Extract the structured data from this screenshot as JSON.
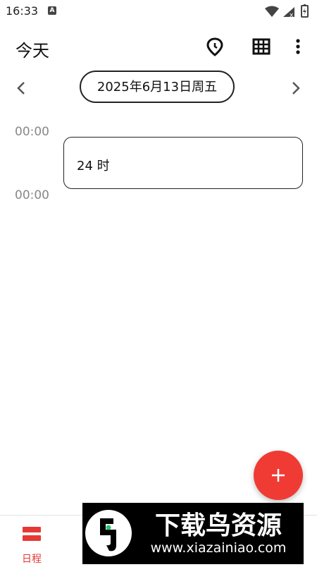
{
  "status_bar": {
    "time": "16:33"
  },
  "toolbar": {
    "title": "今天",
    "icons": [
      "location-pin-icon",
      "grid-calendar-icon",
      "more-vert-icon"
    ]
  },
  "date_nav": {
    "date_label": "2025年6月13日周五",
    "prev_icon": "chevron-left-icon",
    "next_icon": "chevron-right-icon"
  },
  "timeline": {
    "start_label": "00:00",
    "end_label": "00:00",
    "event_label": "24 时"
  },
  "fab": {
    "icon": "plus-icon"
  },
  "bottom_nav": {
    "items": [
      {
        "label": "日程",
        "icon": "schedule-icon",
        "active": true
      }
    ]
  },
  "watermark": {
    "title": "下载鸟资源",
    "url": "www.xiazainiao.com"
  },
  "colors": {
    "accent": "#f03b35",
    "nav_active": "#e53935"
  }
}
